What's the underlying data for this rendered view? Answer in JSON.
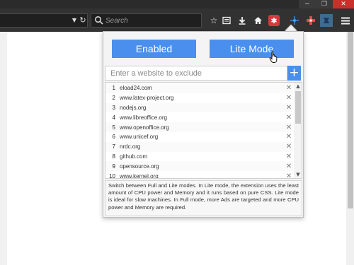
{
  "browser": {
    "url_dropdown_icon": "dropdown-arrow-icon",
    "reload_icon": "reload-icon",
    "search": {
      "placeholder": "Search"
    },
    "toolbar_icons": [
      "star-icon",
      "reader-icon",
      "download-icon",
      "home-icon",
      "adblock-extension-icon",
      "extension-icon",
      "lite-mode-extension-icon",
      "menu-icon"
    ]
  },
  "popup": {
    "enabled_button": "Enabled",
    "lite_mode_button": "Lite Mode",
    "exclude_input": {
      "placeholder": "Enter a website to exclude",
      "value": ""
    },
    "add_button": "+",
    "excluded_sites": [
      {
        "num": "1",
        "site": "eload24.com"
      },
      {
        "num": "2",
        "site": "www.latex-project.org"
      },
      {
        "num": "3",
        "site": "nodejs.org"
      },
      {
        "num": "4",
        "site": "www.libreoffice.org"
      },
      {
        "num": "5",
        "site": "www.openoffice.org"
      },
      {
        "num": "6",
        "site": "www.unicef.org"
      },
      {
        "num": "7",
        "site": "nrdc.org"
      },
      {
        "num": "8",
        "site": "github.com"
      },
      {
        "num": "9",
        "site": "opensource.org"
      },
      {
        "num": "10",
        "site": "www.kernel.org"
      }
    ],
    "remove_glyph": "✕",
    "description": "Switch between Full and Lite modes. In Lite mode, the extension uses the least amount of CPU power and Memory and it runs based on pure CSS. Lite mode is ideal for slow machines. In Full mode, more Ads are targeted and more CPU power and Memory are required."
  },
  "colors": {
    "accent_blue": "#4a8fed",
    "toolbar_bg": "#323232",
    "close_red": "#c7302b"
  }
}
